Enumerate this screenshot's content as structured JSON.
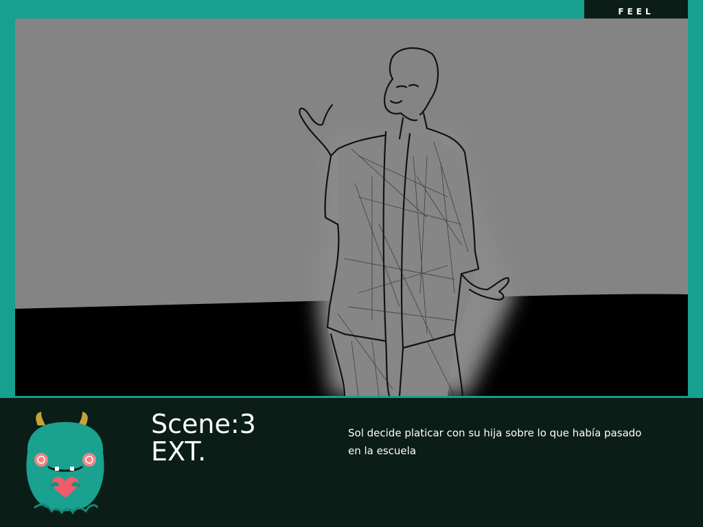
{
  "header": {
    "tag_label": "FEEL"
  },
  "frame": {
    "illustration": "sketch-woman-gesturing"
  },
  "footer": {
    "scene_label": "Scene:3",
    "location_label": "EXT.",
    "caption": "Sol decide platicar con su hija sobre lo que había pasado en la escuela"
  },
  "colors": {
    "teal": "#16a08f",
    "dark": "#0b1d17",
    "sketch_gray": "#848484"
  }
}
